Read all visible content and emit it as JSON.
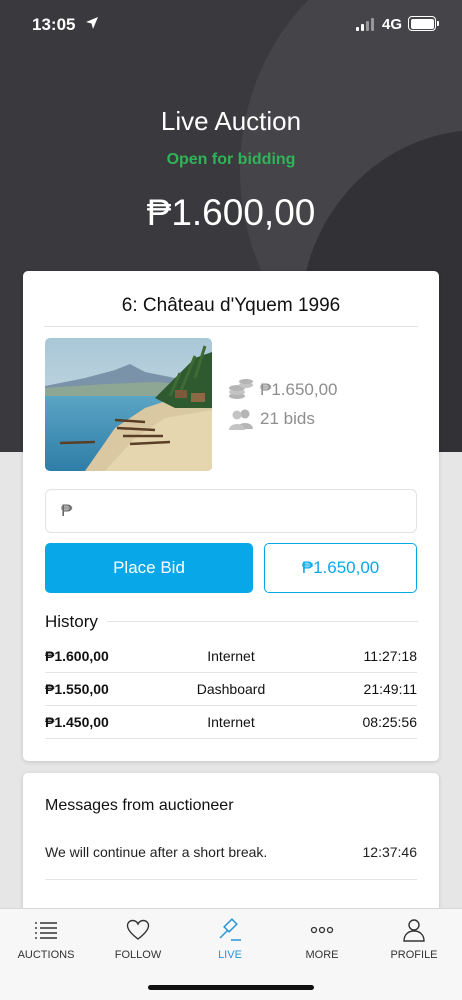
{
  "status_bar": {
    "time": "13:05",
    "network": "4G"
  },
  "header": {
    "title": "Live Auction",
    "status": "Open for bidding",
    "current_price": "₱1.600,00"
  },
  "lot": {
    "title": "6: Château d'Yquem 1996",
    "next_bid": "₱1.650,00",
    "bids": "21 bids",
    "image_icon": "painting-image"
  },
  "bid_form": {
    "currency_placeholder": "₱",
    "place_bid_label": "Place Bid",
    "quick_bid_label": "₱1.650,00"
  },
  "history": {
    "label": "History",
    "rows": [
      {
        "amount": "₱1.600,00",
        "source": "Internet",
        "time": "11:27:18"
      },
      {
        "amount": "₱1.550,00",
        "source": "Dashboard",
        "time": "21:49:11"
      },
      {
        "amount": "₱1.450,00",
        "source": "Internet",
        "time": "08:25:56"
      }
    ]
  },
  "messages": {
    "heading": "Messages from auctioneer",
    "items": [
      {
        "text": "We will continue after a short break.",
        "time": "12:37:46"
      }
    ]
  },
  "tabs": [
    {
      "label": "AUCTIONS",
      "icon": "list-icon",
      "active": false
    },
    {
      "label": "FOLLOW",
      "icon": "heart-icon",
      "active": false
    },
    {
      "label": "LIVE",
      "icon": "gavel-icon",
      "active": true
    },
    {
      "label": "MORE",
      "icon": "more-icon",
      "active": false
    },
    {
      "label": "PROFILE",
      "icon": "user-icon",
      "active": false
    }
  ],
  "colors": {
    "accent": "#08a8e8",
    "status_green": "#2fb457",
    "active_tab": "#2a95d6",
    "header_bg": "#3a3a3e"
  }
}
